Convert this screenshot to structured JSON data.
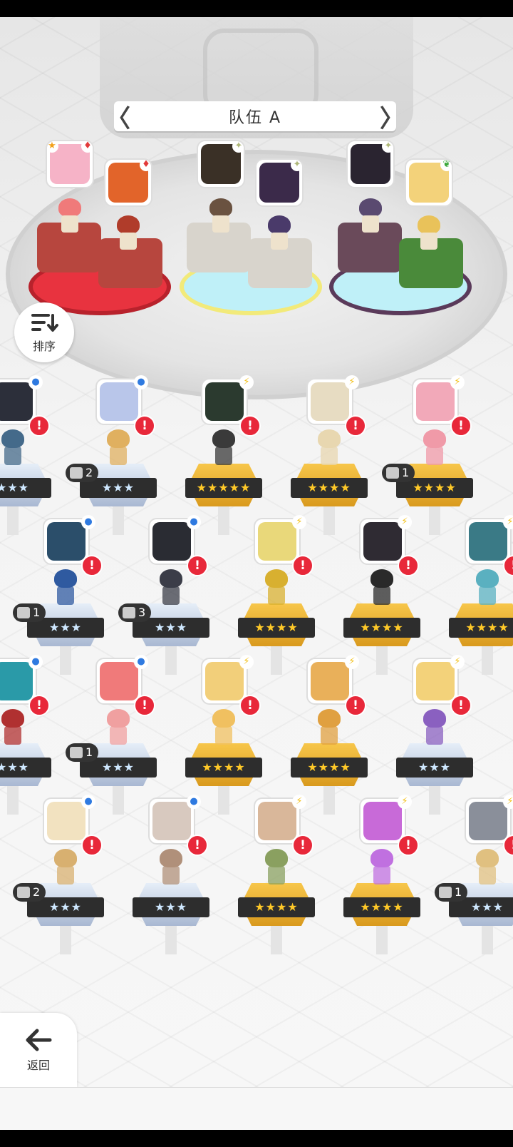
{
  "team": {
    "name": "队伍 A",
    "prev_label": "〈",
    "next_label": "〉"
  },
  "sort_button": {
    "label": "排序",
    "icon": "sort-icon"
  },
  "back_button": {
    "label": "返回",
    "icon": "back-arrow-icon"
  },
  "team_slots": [
    {
      "role_icon": "diamond-icon",
      "star_badge": true,
      "colors": {
        "face": "#f6b3c7",
        "sprite": "#f07a7a"
      }
    },
    {
      "role_icon": "diamond-icon",
      "star_badge": false,
      "colors": {
        "face": "#e2642a",
        "sprite": "#b03c2a"
      }
    },
    {
      "role_icon": "sparkle-icon",
      "star_badge": false,
      "colors": {
        "face": "#3a3026",
        "sprite": "#6a5240"
      }
    },
    {
      "role_icon": "sparkle-icon",
      "star_badge": false,
      "colors": {
        "face": "#3b2a4a",
        "sprite": "#4a3a6a"
      }
    },
    {
      "role_icon": "sparkle-icon",
      "star_badge": false,
      "colors": {
        "face": "#2a2430",
        "sprite": "#5a4a70"
      }
    },
    {
      "role_icon": "leaf-icon",
      "star_badge": false,
      "colors": {
        "face": "#f3d27a",
        "sprite": "#e9c25a"
      }
    }
  ],
  "units": [
    {
      "stars": "★★★",
      "tier": "silver",
      "dupe": "",
      "type": "circle-icon",
      "face": "#2c2f3a",
      "spr": "#446a8a"
    },
    {
      "stars": "★★★",
      "tier": "silver",
      "dupe": "2",
      "type": "circle-icon",
      "face": "#b9c6ea",
      "spr": "#e0b060"
    },
    {
      "stars": "★★★★★",
      "tier": "gold",
      "dupe": "",
      "type": "bolt-icon",
      "face": "#2b3a2f",
      "spr": "#3a3a3a"
    },
    {
      "stars": "★★★★",
      "tier": "gold",
      "dupe": "",
      "type": "bolt-icon",
      "face": "#e7dcc2",
      "spr": "#e8d7b0"
    },
    {
      "stars": "★★★★",
      "tier": "gold",
      "dupe": "1",
      "type": "bolt-icon",
      "face": "#f2a9b9",
      "spr": "#f09aa8"
    },
    {
      "stars": "★★★",
      "tier": "silver",
      "dupe": "1",
      "type": "circle-icon",
      "face": "#2b4e6a",
      "spr": "#2f5aa0"
    },
    {
      "stars": "★★★",
      "tier": "silver",
      "dupe": "3",
      "type": "circle-icon",
      "face": "#2a2c33",
      "spr": "#3b3d48"
    },
    {
      "stars": "★★★★",
      "tier": "gold",
      "dupe": "",
      "type": "bolt-icon",
      "face": "#e9d87a",
      "spr": "#d8b030"
    },
    {
      "stars": "★★★★",
      "tier": "gold",
      "dupe": "",
      "type": "bolt-icon",
      "face": "#2f2b33",
      "spr": "#2a2a2a"
    },
    {
      "stars": "★★★★",
      "tier": "gold",
      "dupe": "",
      "type": "bolt-icon",
      "face": "#3a7a86",
      "spr": "#5ab0c0"
    },
    {
      "stars": "★★★",
      "tier": "silver",
      "dupe": "",
      "type": "circle-icon",
      "face": "#2a9aa8",
      "spr": "#b03030"
    },
    {
      "stars": "★★★",
      "tier": "silver",
      "dupe": "1",
      "type": "circle-icon",
      "face": "#f07a7a",
      "spr": "#f0a0a0"
    },
    {
      "stars": "★★★★",
      "tier": "gold",
      "dupe": "",
      "type": "bolt-icon",
      "face": "#f2cf7a",
      "spr": "#f0c060"
    },
    {
      "stars": "★★★★",
      "tier": "gold",
      "dupe": "",
      "type": "bolt-icon",
      "face": "#e9b05a",
      "spr": "#e0a040"
    },
    {
      "stars": "★★★",
      "tier": "silver",
      "dupe": "",
      "type": "bolt-icon",
      "face": "#f3d27a",
      "spr": "#8a60c0"
    },
    {
      "stars": "★★★",
      "tier": "silver",
      "dupe": "2",
      "type": "circle-icon",
      "face": "#f2e2c0",
      "spr": "#d8b070"
    },
    {
      "stars": "★★★",
      "tier": "silver",
      "dupe": "",
      "type": "circle-icon",
      "face": "#d8c9bf",
      "spr": "#b0907a"
    },
    {
      "stars": "★★★★",
      "tier": "gold",
      "dupe": "",
      "type": "bolt-icon",
      "face": "#d9b79a",
      "spr": "#8aa060"
    },
    {
      "stars": "★★★★",
      "tier": "gold",
      "dupe": "",
      "type": "bolt-icon",
      "face": "#c86ad8",
      "spr": "#c070e0"
    },
    {
      "stars": "★★★",
      "tier": "silver",
      "dupe": "1",
      "type": "bolt-icon",
      "face": "#8a8f9a",
      "spr": "#e0c080"
    }
  ]
}
